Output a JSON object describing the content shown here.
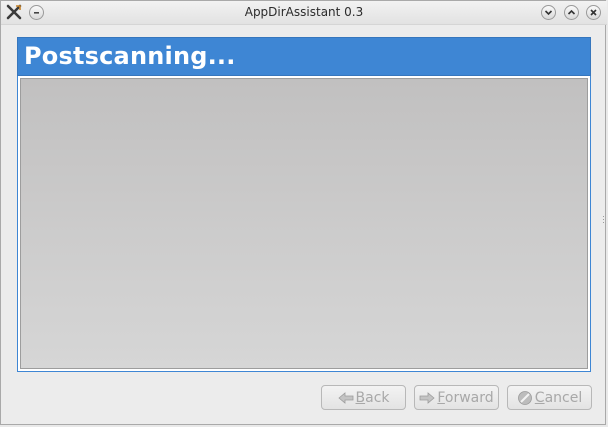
{
  "window": {
    "title": "AppDirAssistant 0.3",
    "icons": {
      "app": "app-x-icon",
      "menu": "window-menu-icon",
      "minimize": "minimize-icon",
      "maximize": "maximize-icon",
      "close": "close-icon"
    }
  },
  "header": {
    "title": "Postscanning..."
  },
  "content": {},
  "buttons": {
    "back": {
      "accel": "B",
      "rest": "ack",
      "icon": "back-arrow-icon",
      "enabled": false
    },
    "forward": {
      "accel": "F",
      "rest": "orward",
      "icon": "forward-arrow-icon",
      "enabled": false
    },
    "cancel": {
      "accel": "C",
      "rest": "ancel",
      "icon": "cancel-icon",
      "enabled": false
    }
  },
  "colors": {
    "header_bg": "#3e86d4",
    "header_text": "#ffffff",
    "content_bg": "#c8c8c8",
    "disabled_text": "#a8a8a8"
  }
}
